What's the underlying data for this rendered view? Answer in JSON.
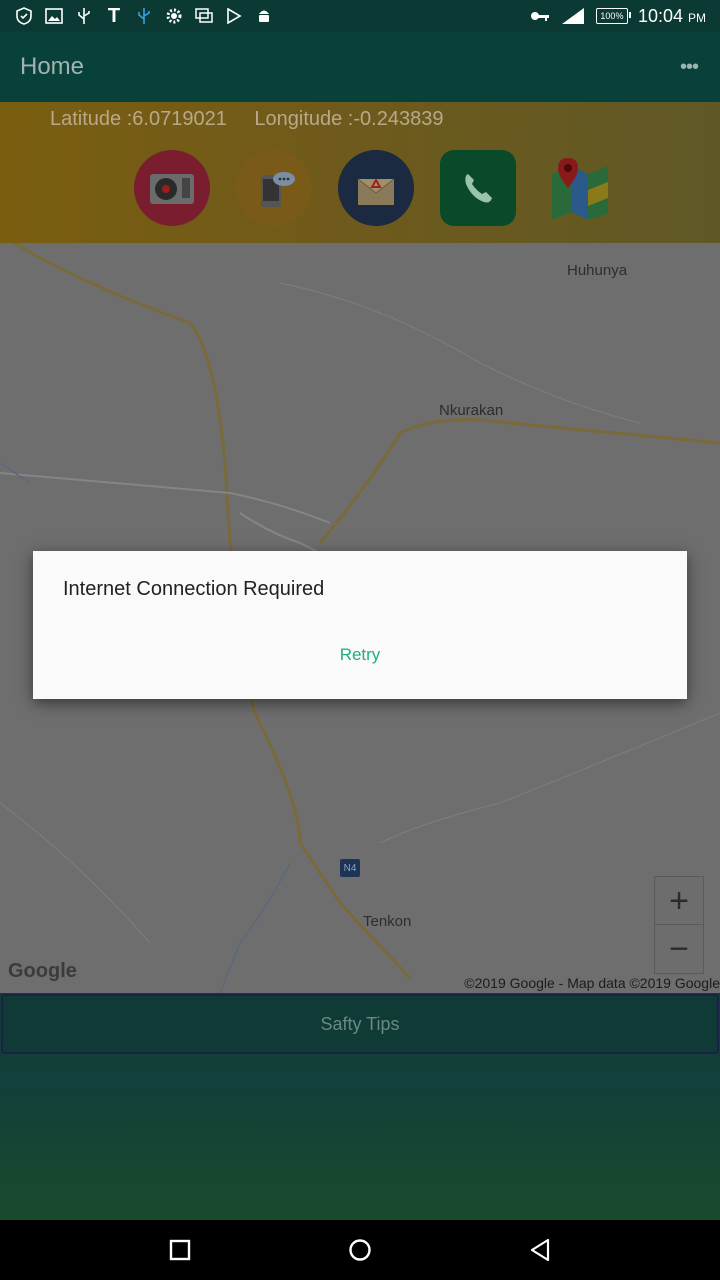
{
  "status_bar": {
    "time": "10:04",
    "ampm": "PM",
    "battery": "100%",
    "icons_left": [
      "shield-icon",
      "image-icon",
      "usb-icon",
      "t-icon",
      "usb-icon",
      "gear-icon",
      "layers-icon",
      "play-store-icon",
      "android-icon"
    ],
    "icons_right": [
      "key-icon",
      "signal-icon",
      "battery-icon"
    ]
  },
  "app_bar": {
    "title": "Home"
  },
  "location": {
    "latitude": "Latitude :6.0719021",
    "longitude": "Longitude :-0.243839"
  },
  "actions": [
    "siren-icon",
    "sms-icon",
    "email-icon",
    "phone-icon",
    "maps-icon"
  ],
  "map": {
    "places": [
      "Huhunya",
      "Nkurakan",
      "Tenkon"
    ],
    "road_badge": "N4",
    "zoom_in": "+",
    "zoom_out": "−",
    "logo": "Google",
    "copyright": "©2019 Google - Map data ©2019 Google"
  },
  "safety_button": "Safty Tips",
  "dialog": {
    "title": "Internet Connection Required",
    "button": "Retry"
  },
  "colors": {
    "accent": "#1db07c",
    "appbar": "#08403a",
    "coords_bar": "#6e5a1c"
  }
}
